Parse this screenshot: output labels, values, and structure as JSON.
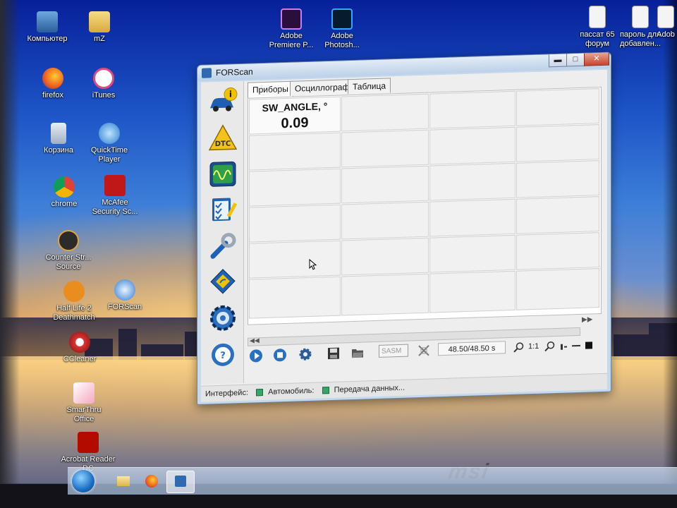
{
  "desktop": {
    "icons": [
      {
        "label": "Компьютер",
        "icon": "computer-icon"
      },
      {
        "label": "mZ",
        "icon": "folder-icon"
      },
      {
        "label": "Adobe Premiere P...",
        "icon": "premiere-icon"
      },
      {
        "label": "Adobe Photosh...",
        "icon": "photoshop-icon"
      },
      {
        "label": "пассат 65 форум",
        "icon": "document-icon"
      },
      {
        "label": "пароль для добавлен...",
        "icon": "document-icon"
      },
      {
        "label": "Adob",
        "icon": "document-icon"
      },
      {
        "label": "firefox",
        "icon": "firefox-icon"
      },
      {
        "label": "iTunes",
        "icon": "itunes-icon"
      },
      {
        "label": "Корзина",
        "icon": "recycle-bin-icon"
      },
      {
        "label": "QuickTime Player",
        "icon": "quicktime-icon"
      },
      {
        "label": "chrome",
        "icon": "chrome-icon"
      },
      {
        "label": "McAfee Security Sc...",
        "icon": "mcafee-icon"
      },
      {
        "label": "Counter Str... Source",
        "icon": "counter-strike-icon"
      },
      {
        "label": "Half Life 2 Deathmatch",
        "icon": "half-life-icon"
      },
      {
        "label": "FORScan",
        "icon": "forscan-icon"
      },
      {
        "label": "CCleaner",
        "icon": "ccleaner-icon"
      },
      {
        "label": "SmarThru Office",
        "icon": "smarthru-icon"
      },
      {
        "label": "Acrobat Reader DC",
        "icon": "acrobat-icon"
      }
    ],
    "brand": "msi"
  },
  "taskbar": {
    "buttons": [
      "start-orb",
      "explorer-icon",
      "firefox-icon",
      "forscan-icon"
    ]
  },
  "window": {
    "title": "FORScan",
    "controls": {
      "minimize": "▬",
      "maximize": "□",
      "close": "✕"
    },
    "sidebar": [
      {
        "name": "info-car",
        "icon": "car-info-icon"
      },
      {
        "name": "dtc",
        "icon": "dtc-warning-icon",
        "label": "DTC"
      },
      {
        "name": "oscilloscope",
        "icon": "oscilloscope-icon"
      },
      {
        "name": "checklist",
        "icon": "checklist-icon"
      },
      {
        "name": "service",
        "icon": "wrench-icon"
      },
      {
        "name": "modules",
        "icon": "chip-icon"
      },
      {
        "name": "settings",
        "icon": "gear-icon"
      },
      {
        "name": "help",
        "icon": "steering-help-icon"
      }
    ],
    "tabs": [
      "Приборы",
      "Осциллограф",
      "Таблица"
    ],
    "active_tab": "Приборы",
    "gauge": {
      "name": "SW_ANGLE, °",
      "value": "0.09"
    },
    "toolbar": {
      "combo_value": "SASM",
      "time": "48.50/48.50 s",
      "ratio": "1:1"
    },
    "status": {
      "interface_label": "Интерфейс:",
      "vehicle_label": "Автомобиль:",
      "transfer_label": "Передача данных..."
    }
  }
}
